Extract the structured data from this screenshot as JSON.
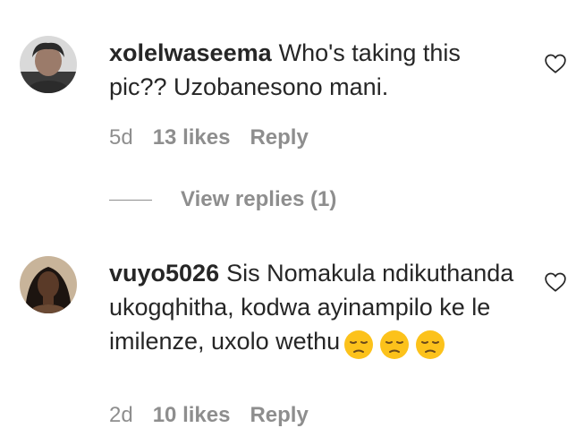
{
  "comments": [
    {
      "username": "xolelwaseema",
      "text": "Who's taking this pic?? Uzobanesono mani.",
      "time": "5d",
      "likes": "13 likes",
      "reply": "Reply",
      "avatar_icon": "user-avatar-photo",
      "like_icon": "heart-outline-icon"
    },
    {
      "username": "vuyo5026",
      "text": "Sis Nomakula ndikuthanda ukogqhitha, kodwa ayinampilo ke le imilenze, uxolo wethu",
      "emojis": [
        "😔",
        "😔",
        "😔"
      ],
      "time": "2d",
      "likes": "10 likes",
      "reply": "Reply",
      "avatar_icon": "user-avatar-photo",
      "like_icon": "heart-outline-icon"
    }
  ],
  "view_replies": {
    "label": "View replies (1)"
  },
  "colors": {
    "text": "#262626",
    "muted": "#8e8e8e"
  }
}
